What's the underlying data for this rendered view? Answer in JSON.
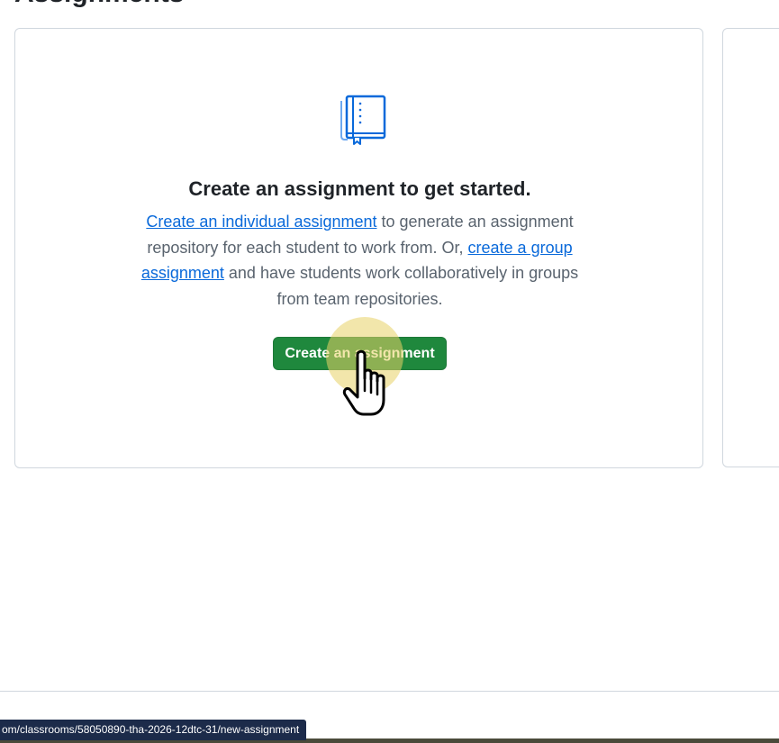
{
  "page": {
    "heading": "Assignments"
  },
  "blankslate": {
    "icon": "book-icon",
    "title": "Create an assignment to get started.",
    "link_individual": "Create an individual assignment",
    "text_1": " to generate an assignment repository for each student to work from. Or, ",
    "link_group": "create a group assignment",
    "text_2": " and have students work collaboratively in groups from team repositories.",
    "button_label": "Create an assignment"
  },
  "status_bar": {
    "url": "om/classrooms/58050890-tha-2026-12dtc-31/new-assignment"
  },
  "colors": {
    "primary_button": "#1f883d",
    "link": "#0969da",
    "icon": "#0969da",
    "cursor_highlight": "#e8d266"
  }
}
